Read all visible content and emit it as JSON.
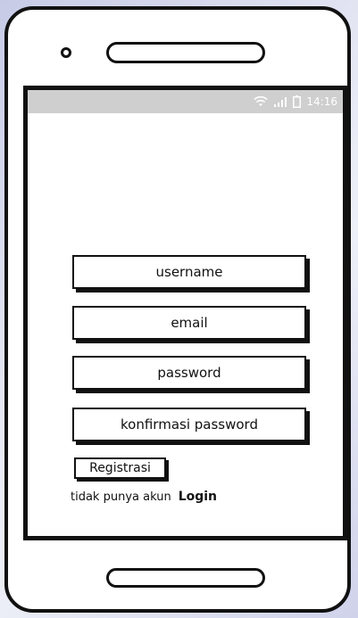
{
  "status_bar": {
    "time": "14:16",
    "icons": [
      "wifi-icon",
      "signal-icon",
      "battery-icon"
    ]
  },
  "form": {
    "username_placeholder": "username",
    "email_placeholder": "email",
    "password_placeholder": "password",
    "confirm_password_placeholder": "konfirmasi password",
    "register_label": "Registrasi"
  },
  "footer": {
    "no_account_text": "tidak punya akun",
    "login_link": "Login"
  },
  "colors": {
    "status_bar": "#cfcfcf",
    "outline": "#111111",
    "background": "#ffffff"
  }
}
